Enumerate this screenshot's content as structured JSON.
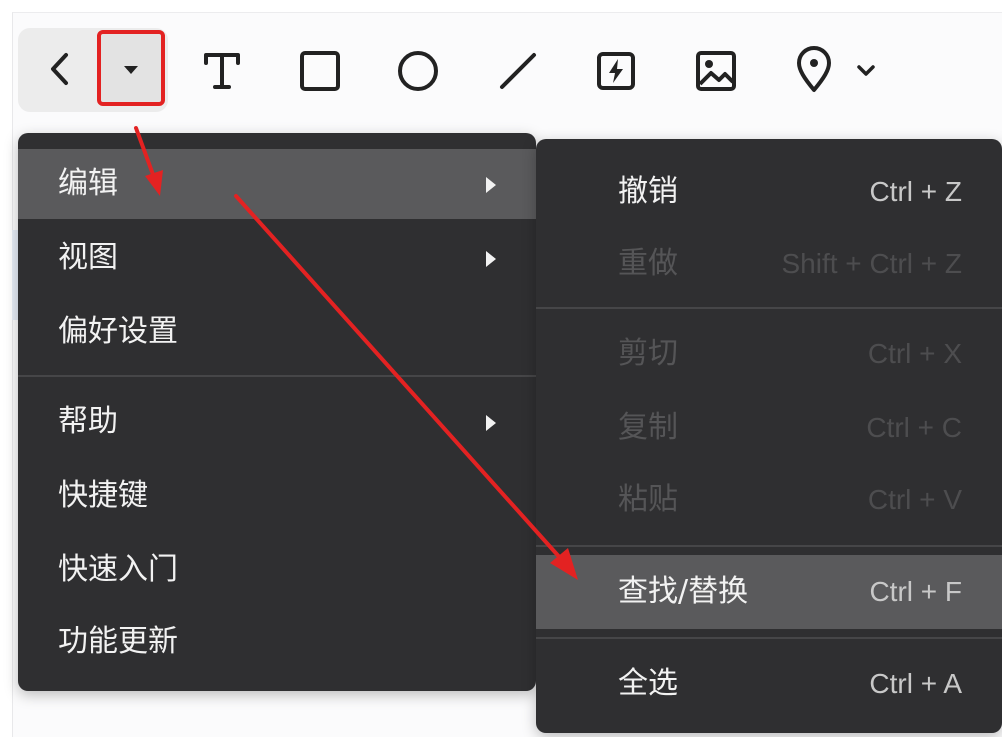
{
  "toolbar": {
    "tools": [
      {
        "name": "back-icon"
      },
      {
        "name": "dropdown-menu-icon"
      },
      {
        "name": "text-tool-icon"
      },
      {
        "name": "rectangle-tool-icon"
      },
      {
        "name": "ellipse-tool-icon"
      },
      {
        "name": "line-tool-icon"
      },
      {
        "name": "flash-tool-icon"
      },
      {
        "name": "image-tool-icon"
      },
      {
        "name": "location-pin-icon"
      },
      {
        "name": "chevron-down-icon"
      }
    ]
  },
  "main_menu": {
    "items": [
      {
        "label": "编辑",
        "has_submenu": true,
        "active": true
      },
      {
        "label": "视图",
        "has_submenu": true
      },
      {
        "label": "偏好设置",
        "has_submenu": false
      },
      {
        "label": "帮助",
        "has_submenu": true
      },
      {
        "label": "快捷键",
        "has_submenu": false
      },
      {
        "label": "快速入门",
        "has_submenu": false
      },
      {
        "label": "功能更新",
        "has_submenu": false
      }
    ]
  },
  "edit_submenu": {
    "items": [
      {
        "label": "撤销",
        "shortcut": "Ctrl + Z",
        "enabled": true
      },
      {
        "label": "重做",
        "shortcut": "Shift + Ctrl + Z",
        "enabled": false
      },
      {
        "label": "剪切",
        "shortcut": "Ctrl + X",
        "enabled": false
      },
      {
        "label": "复制",
        "shortcut": "Ctrl + C",
        "enabled": false
      },
      {
        "label": "粘贴",
        "shortcut": "Ctrl + V",
        "enabled": false
      },
      {
        "label": "查找/替换",
        "shortcut": "Ctrl + F",
        "enabled": true,
        "active": true
      },
      {
        "label": "全选",
        "shortcut": "Ctrl + A",
        "enabled": true
      }
    ]
  },
  "colors": {
    "menu_bg": "#2f2f31",
    "menu_active": "#5a5a5c",
    "annotation_red": "#e32222"
  }
}
